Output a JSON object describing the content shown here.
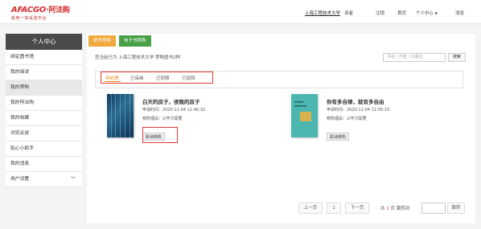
{
  "header": {
    "logo_brand": "AFACGO",
    "logo_dot": "·",
    "logo_cn": "阿法购",
    "logo_subtitle": "纸电一体采选平台",
    "university": "上海工程技术大学",
    "role": "读者",
    "logout": "注销",
    "home": "首页",
    "personal_center": "个人中心",
    "messages": "消息"
  },
  "sidebar": {
    "title": "个人中心",
    "items": [
      {
        "label": "绑定图书馆"
      },
      {
        "label": "我的阅读"
      },
      {
        "label": "我的荐购"
      },
      {
        "label": "我的阿法购"
      },
      {
        "label": "我的收藏"
      },
      {
        "label": "浏览足迹"
      },
      {
        "label": "贴心小助手"
      },
      {
        "label": "我的消息"
      },
      {
        "label": "用户设置"
      }
    ]
  },
  "main": {
    "tab_paper": "纸书荐购",
    "tab_ebook": "电子书荐购",
    "info_text": "您当前已为 上海工程技术大学 荐购图书2种",
    "search_placeholder": "书名 / 作者 / 出版社",
    "search_button": "搜索",
    "status_tabs": [
      "待处理",
      "已采纳",
      "已到馆",
      "已驳回"
    ],
    "books": [
      {
        "title": "白天的房子，夜晚的房子",
        "time": "申请时间：2020-11-04 11:46:32",
        "reason": "荐购理由：☑学习需要",
        "cancel": "取消荐购"
      },
      {
        "title": "你有多自律，就有多自由",
        "time": "申请时间：2020-11-04 11:05:10",
        "reason": "荐购理由：☑学习需要",
        "cancel": "取消荐购"
      }
    ]
  },
  "pager": {
    "prev": "上一页",
    "page": "1",
    "next": "下一页",
    "total_prefix": "共",
    "total_pages": "1",
    "total_suffix": "页",
    "jump_to": "跳转到",
    "jump_button": "跳转"
  }
}
